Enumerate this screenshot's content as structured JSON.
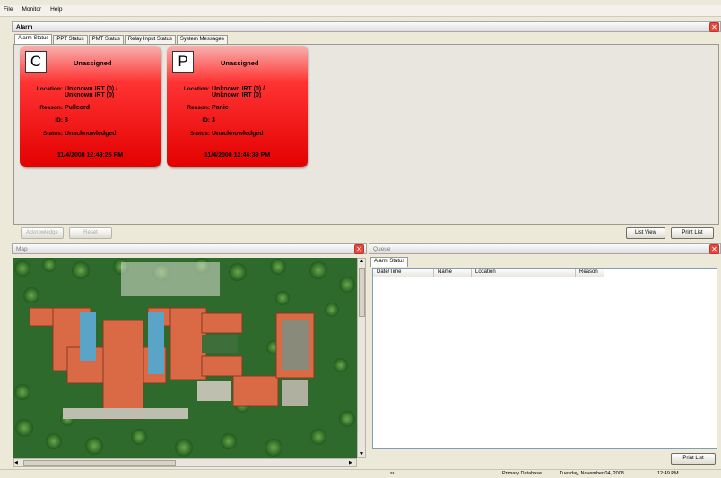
{
  "menu": [
    "File",
    "Monitor",
    "Help"
  ],
  "alarm_panel": {
    "title": "Alarm",
    "tabs": [
      "Alarm Status",
      "PPT Status",
      "PMT Status",
      "Relay Input Status",
      "System Messages"
    ],
    "cards": [
      {
        "letter": "C",
        "assignment": "Unassigned",
        "location_label": "Location:",
        "location": "Unknown IRT (0) / Unknown IRT (0)",
        "reason_label": "Reason:",
        "reason": "Pullcord",
        "id_label": "ID:",
        "id": "3",
        "status_label": "Status:",
        "status": "Unacknowledged",
        "timestamp": "11/4/2008 12:49:25 PM"
      },
      {
        "letter": "P",
        "assignment": "Unassigned",
        "location_label": "Location:",
        "location": "Unknown IRT (0) / Unknown IRT (0)",
        "reason_label": "Reason:",
        "reason": "Panic",
        "id_label": "ID:",
        "id": "3",
        "status_label": "Status:",
        "status": "Unacknowledged",
        "timestamp": "11/4/2008 12:46:39 PM"
      }
    ],
    "buttons": {
      "acknowledge": "Acknowledge",
      "reset": "Reset",
      "list_view": "List View",
      "print_list": "Print List"
    }
  },
  "map_panel": {
    "title": "Map"
  },
  "queue_panel": {
    "title": "Queue",
    "tab": "Alarm Status",
    "columns": [
      "Date/Time",
      "Name",
      "Location",
      "Reason"
    ],
    "print_list": "Print List"
  },
  "statusbar": {
    "user": "su",
    "database": "Primary Database",
    "date": "Tuesday, November 04, 2008",
    "time": "12:49 PM"
  },
  "colors": {
    "card_red": "#e30000",
    "close_red": "#e74a3b"
  }
}
